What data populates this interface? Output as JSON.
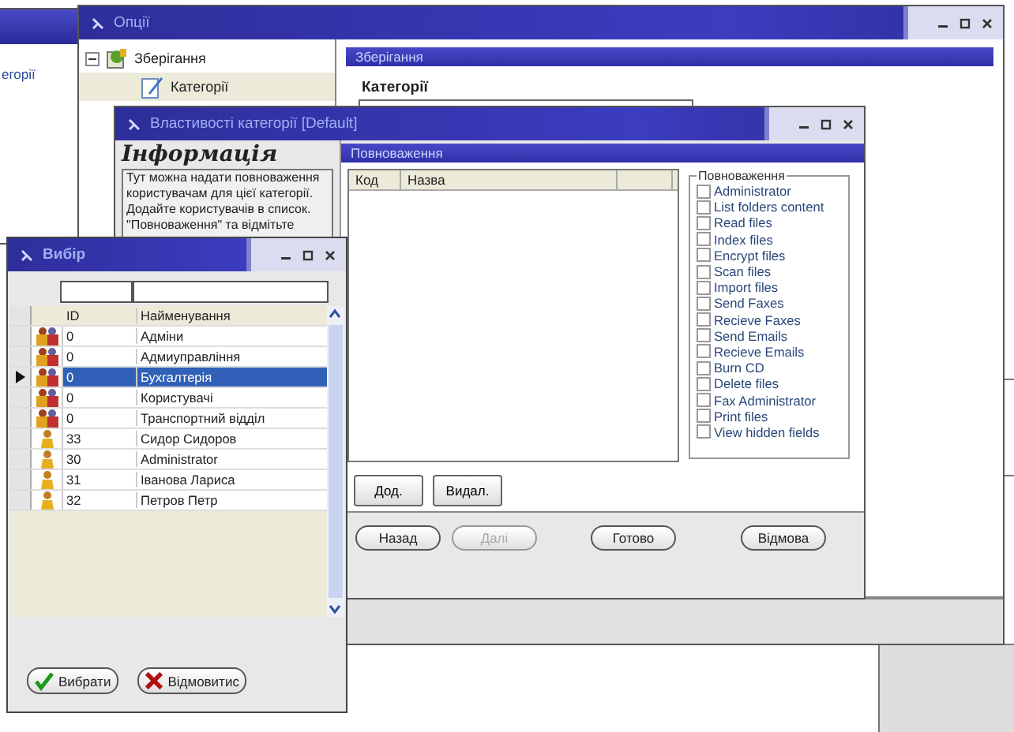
{
  "background_window": {
    "text": "егорії"
  },
  "options_window": {
    "title": "Опції",
    "tree": [
      {
        "label": "Зберігання",
        "expanded": true,
        "selected": false,
        "children": [
          {
            "label": "Категорії",
            "selected": true
          }
        ]
      }
    ],
    "panel_title": "Зберігання",
    "section_title": "Категорії"
  },
  "properties_dialog": {
    "title": "Властивості категорії [Default]",
    "info_heading": "Інформація",
    "info_text": "Тут можна надати повноваження користувачам для цієї категорії. Додайте користувачів в список. \"Повноваження\" та відмітьте",
    "panel_title": "Повноваження",
    "table": {
      "columns": [
        "Код",
        "Назва"
      ]
    },
    "group_title": "Повноваження",
    "permissions": [
      {
        "label": "Administrator",
        "checked": false
      },
      {
        "label": "List folders content",
        "checked": false
      },
      {
        "label": "Read files",
        "checked": false
      },
      {
        "label": "Index files",
        "checked": false
      },
      {
        "label": "Encrypt files",
        "checked": false
      },
      {
        "label": "Scan files",
        "checked": false
      },
      {
        "label": "Import files",
        "checked": false
      },
      {
        "label": "Send Faxes",
        "checked": false
      },
      {
        "label": "Recieve Faxes",
        "checked": false
      },
      {
        "label": "Send Emails",
        "checked": false
      },
      {
        "label": "Recieve Emails",
        "checked": false
      },
      {
        "label": "Burn CD",
        "checked": false
      },
      {
        "label": "Delete files",
        "checked": false
      },
      {
        "label": "Fax Administrator",
        "checked": false
      },
      {
        "label": "Print files",
        "checked": false
      },
      {
        "label": "View hidden fields",
        "checked": false
      }
    ],
    "list_buttons": [
      {
        "label": "Дод.",
        "disabled": false
      },
      {
        "label": "Видал.",
        "disabled": false
      }
    ],
    "nav_buttons": [
      {
        "label": "Назад",
        "disabled": false
      },
      {
        "label": "Далі",
        "disabled": true
      },
      {
        "label": "Готово",
        "disabled": false
      },
      {
        "label": "Відмова",
        "disabled": false
      }
    ]
  },
  "choose_window": {
    "title": "Вибір",
    "columns": [
      "ID",
      "Найменування"
    ],
    "rows": [
      {
        "kind": "group",
        "id": "0",
        "name": "Адміни",
        "selected": false
      },
      {
        "kind": "group",
        "id": "0",
        "name": "Адмиуправління",
        "selected": false
      },
      {
        "kind": "group",
        "id": "0",
        "name": "Бухгалтерія",
        "selected": true
      },
      {
        "kind": "group",
        "id": "0",
        "name": "Користувачі",
        "selected": false
      },
      {
        "kind": "group",
        "id": "0",
        "name": "Транспортний відділ",
        "selected": false
      },
      {
        "kind": "user",
        "id": "33",
        "name": " Сидор Сидоров",
        "selected": false
      },
      {
        "kind": "user",
        "id": "30",
        "name": "Administrator",
        "selected": false
      },
      {
        "kind": "user",
        "id": "31",
        "name": "Іванова Лариса",
        "selected": false
      },
      {
        "kind": "user",
        "id": "32",
        "name": "Петров Петр",
        "selected": false
      }
    ],
    "buttons": [
      {
        "label": "Вибрати",
        "kind": "ok"
      },
      {
        "label": "Відмовитис",
        "kind": "cancel"
      }
    ]
  }
}
